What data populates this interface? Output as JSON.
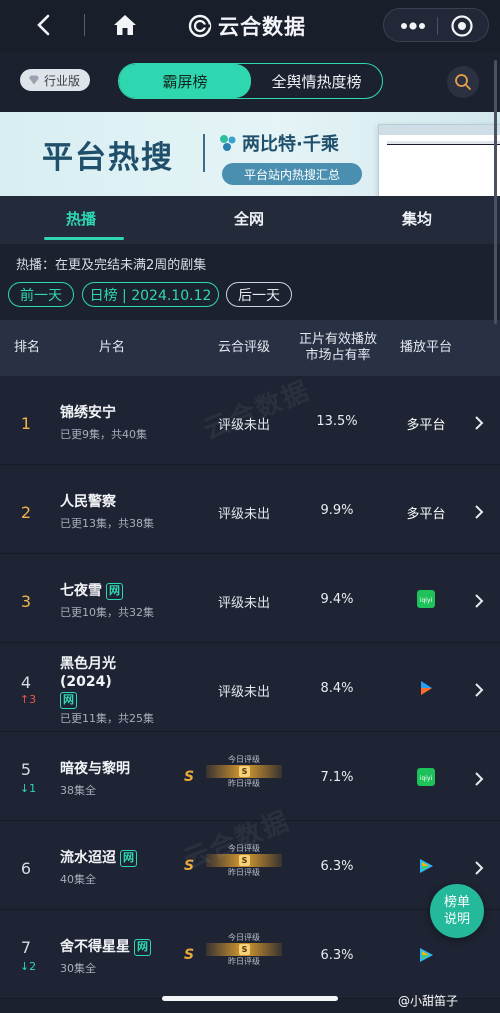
{
  "app": {
    "title": "云合数据"
  },
  "filter": {
    "badge": "行业版",
    "segments": [
      "霸屏榜",
      "全舆情热度榜"
    ]
  },
  "banner": {
    "headline": "平台热搜",
    "brand": "两比特·千乘",
    "tagline": "平台站内热搜汇总"
  },
  "tabs": [
    "热播",
    "全网",
    "集均"
  ],
  "note": "热播：在更及完结未满2周的剧集",
  "dates": {
    "prev": "前一天",
    "current": "日榜 | 2024.10.12",
    "next": "后一天"
  },
  "columns": {
    "rank": "排名",
    "name": "片名",
    "rating": "云合评级",
    "share_line1": "正片有效播放",
    "share_line2": "市场占有率",
    "platform": "播放平台"
  },
  "gauge_labels": {
    "today": "今日评级",
    "yesterday": "昨日评级",
    "grade": "S"
  },
  "rows": [
    {
      "rank": "1",
      "trend": "",
      "title": "锦绣安宁",
      "title2": "",
      "net": false,
      "sub": "已更9集，共40集",
      "rating": "评级未出",
      "share": "13.5%",
      "platform": "多平台"
    },
    {
      "rank": "2",
      "trend": "",
      "title": "人民警察",
      "title2": "",
      "net": false,
      "sub": "已更13集，共38集",
      "rating": "评级未出",
      "share": "9.9%",
      "platform": "多平台"
    },
    {
      "rank": "3",
      "trend": "",
      "title": "七夜雪",
      "title2": "",
      "net": true,
      "sub": "已更10集，共32集",
      "rating": "评级未出",
      "share": "9.4%",
      "platform": ""
    },
    {
      "rank": "4",
      "trend": "3",
      "title": "黑色月光",
      "title2": "(2024)",
      "net": true,
      "sub": "已更11集，共25集",
      "rating": "评级未出",
      "share": "8.4%",
      "platform": ""
    },
    {
      "rank": "5",
      "trend": "1",
      "title": "暗夜与黎明",
      "title2": "",
      "net": false,
      "sub": "38集全",
      "rating": "S",
      "share": "7.1%",
      "platform": ""
    },
    {
      "rank": "6",
      "trend": "",
      "title": "流水迢迢",
      "title2": "",
      "net": true,
      "sub": "40集全",
      "rating": "S",
      "share": "6.3%",
      "platform": ""
    },
    {
      "rank": "7",
      "trend": "2",
      "title": "舍不得星星",
      "title2": "",
      "net": true,
      "sub": "30集全",
      "rating": "S",
      "share": "6.3%",
      "platform": ""
    }
  ],
  "net_tag": "网",
  "float_button": {
    "line1": "榜单",
    "line2": "说明"
  },
  "author": "@小甜笛子",
  "platform_icons": [
    "iqiyi-icon",
    "iqiyi-icon",
    "youku-icon",
    "iqiyi-icon",
    "tencent-video-icon",
    "tencent-video-icon"
  ],
  "colors": {
    "accent": "#2fd7b1",
    "gold": "#f0b44a",
    "up": "#e8574a",
    "down": "#2fd7b1"
  }
}
